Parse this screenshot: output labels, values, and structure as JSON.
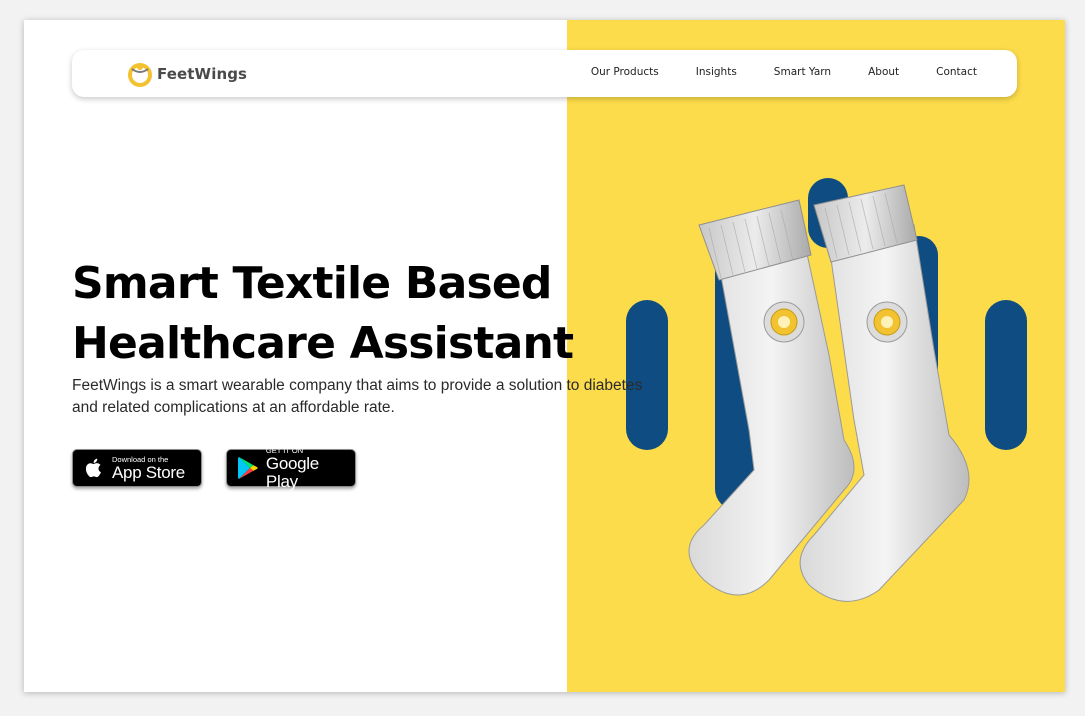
{
  "brand": {
    "name": "FeetWings"
  },
  "nav": {
    "items": [
      "Our Products",
      "Insights",
      "Smart Yarn",
      "About",
      "Contact"
    ]
  },
  "hero": {
    "title_line1": "Smart Textile Based",
    "title_line2": "Healthcare Assistant",
    "description": "FeetWings is a smart wearable company that aims to provide a solution to diabetes and related complications at an affordable rate."
  },
  "badges": {
    "app_store": {
      "small": "Download on the",
      "big": "App Store"
    },
    "google_play": {
      "small": "GET IT ON",
      "big": "Google Play"
    }
  },
  "colors": {
    "accent_yellow": "#FCDC4A",
    "accent_blue": "#0F4C81",
    "sensor_yellow": "#F2C230"
  },
  "icons": [
    "feetwings-logo-icon",
    "apple-icon",
    "google-play-icon",
    "sensor-icon"
  ]
}
